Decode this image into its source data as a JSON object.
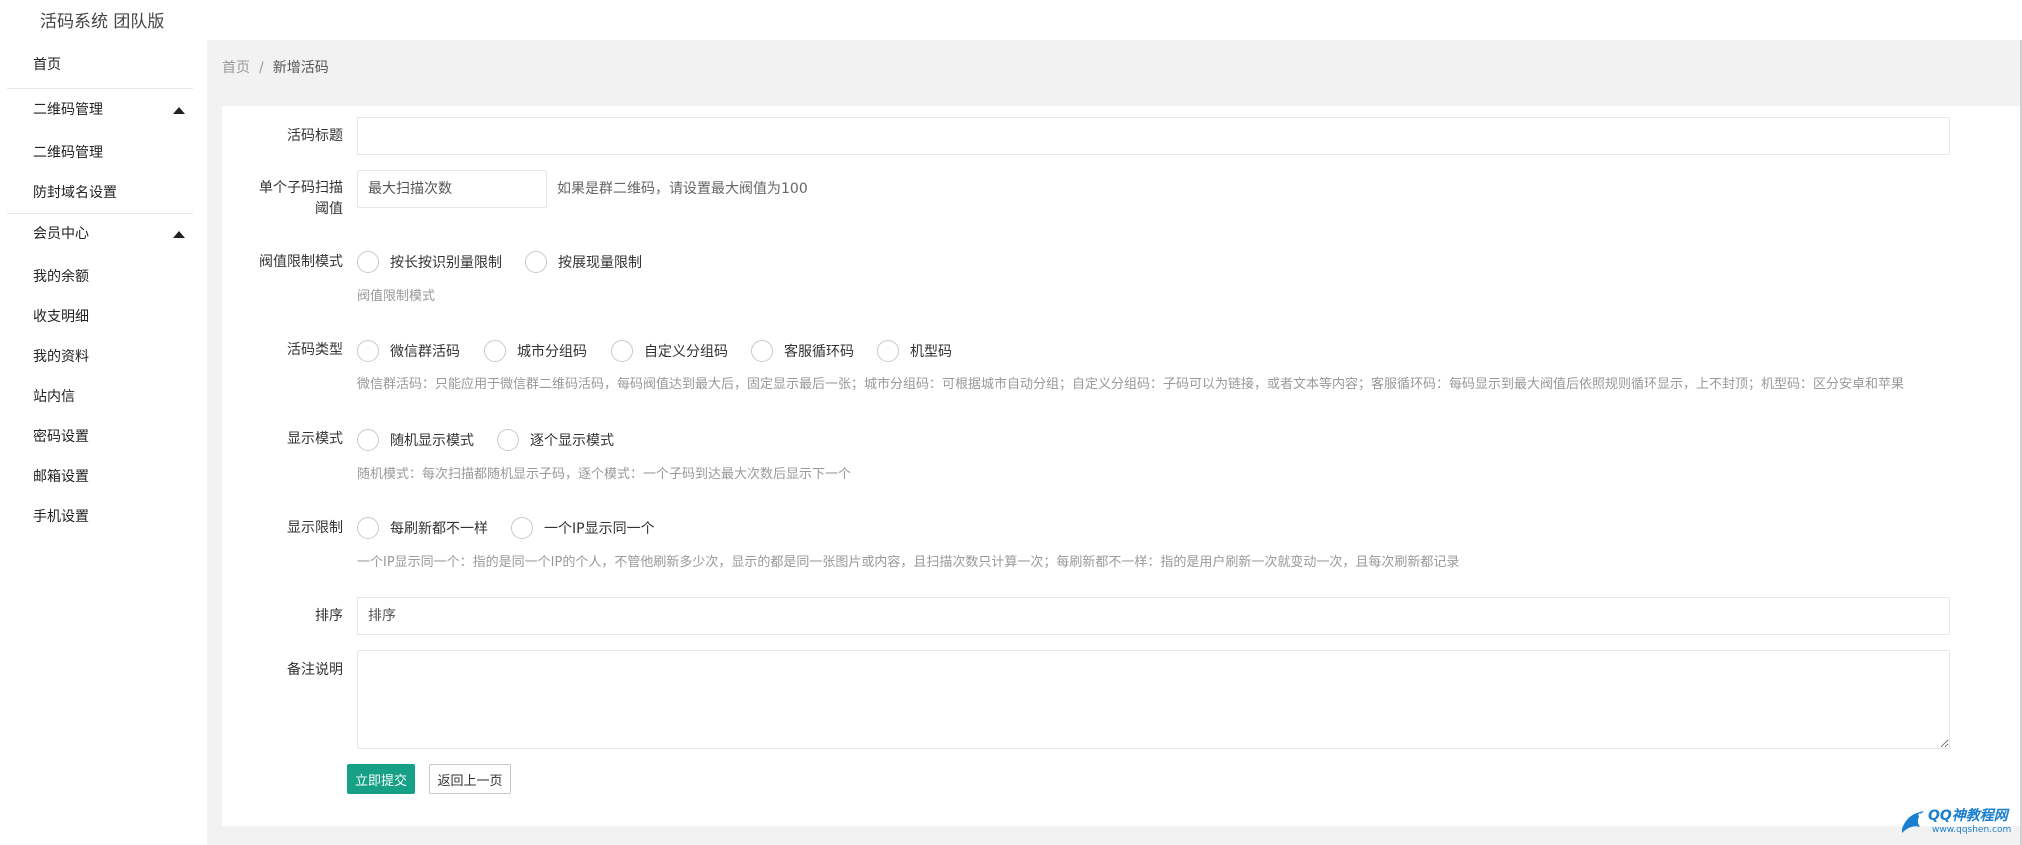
{
  "app": {
    "title": "活码系统 团队版"
  },
  "sidebar": {
    "items": [
      {
        "label": "首页"
      },
      {
        "label": "二维码管理"
      },
      {
        "label": "二维码管理"
      },
      {
        "label": "防封域名设置"
      },
      {
        "label": "会员中心"
      },
      {
        "label": "我的余额"
      },
      {
        "label": "收支明细"
      },
      {
        "label": "我的资料"
      },
      {
        "label": "站内信"
      },
      {
        "label": "密码设置"
      },
      {
        "label": "邮箱设置"
      },
      {
        "label": "手机设置"
      }
    ]
  },
  "breadcrumb": {
    "home": "首页",
    "separator": "/",
    "current": "新增活码"
  },
  "form": {
    "title": {
      "label": "活码标题",
      "value": "",
      "placeholder": ""
    },
    "threshold": {
      "label_line1": "单个子码扫描",
      "label_line2": "阈值",
      "value": "",
      "placeholder": "最大扫描次数",
      "aux": "如果是群二维码，请设置最大阀值为100"
    },
    "limit_mode": {
      "label": "阀值限制模式",
      "options": [
        "按长按识别量限制",
        "按展现量限制"
      ],
      "tip": "阀值限制模式"
    },
    "code_type": {
      "label": "活码类型",
      "options": [
        "微信群活码",
        "城市分组码",
        "自定义分组码",
        "客服循环码",
        "机型码"
      ],
      "tip": "微信群活码：只能应用于微信群二维码活码，每码阀值达到最大后，固定显示最后一张；城市分组码：可根据城市自动分组；自定义分组码：子码可以为链接，或者文本等内容；客服循环码：每码显示到最大阀值后依照规则循环显示，上不封顶；机型码：区分安卓和苹果"
    },
    "display_mode": {
      "label": "显示模式",
      "options": [
        "随机显示模式",
        "逐个显示模式"
      ],
      "tip": "随机模式：每次扫描都随机显示子码，逐个模式：一个子码到达最大次数后显示下一个"
    },
    "display_limit": {
      "label": "显示限制",
      "options": [
        "每刷新都不一样",
        "一个IP显示同一个"
      ],
      "tip": "一个IP显示同一个：指的是同一个IP的个人，不管他刷新多少次，显示的都是同一张图片或内容，且扫描次数只计算一次；每刷新都不一样：指的是用户刷新一次就变动一次，且每次刷新都记录"
    },
    "sort": {
      "label": "排序",
      "value": "",
      "placeholder": "排序"
    },
    "remark": {
      "label": "备注说明",
      "value": ""
    },
    "submit_label": "立即提交",
    "back_label": "返回上一页"
  },
  "watermark": {
    "text": "QQ神教程网",
    "sub": "www.qqshen.com"
  },
  "colors": {
    "primary": "#16a085",
    "content_bg": "#f2f2f2",
    "watermark": "#1a7fd0"
  }
}
